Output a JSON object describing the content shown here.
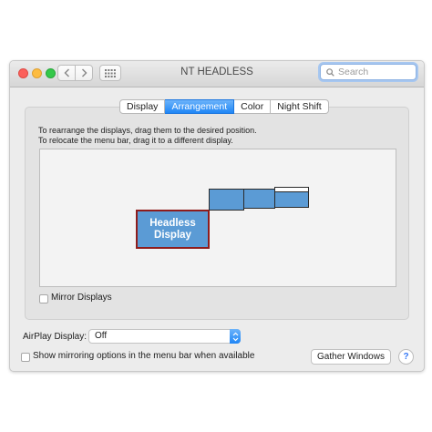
{
  "window": {
    "title": "NT HEADLESS"
  },
  "search": {
    "placeholder": "Search"
  },
  "tabs": [
    {
      "label": "Display",
      "active": false
    },
    {
      "label": "Arrangement",
      "active": true
    },
    {
      "label": "Color",
      "active": false
    },
    {
      "label": "Night Shift",
      "active": false
    }
  ],
  "instructions": {
    "line1": "To rearrange the displays, drag them to the desired position.",
    "line2": "To relocate the menu bar, drag it to a different display."
  },
  "arrangement": {
    "main_display_label_line1": "Headless",
    "main_display_label_line2": "Display"
  },
  "mirror_displays": {
    "label": "Mirror Displays",
    "checked": false
  },
  "airplay": {
    "label": "AirPlay Display:",
    "value": "Off"
  },
  "show_mirroring": {
    "label": "Show mirroring options in the menu bar when available",
    "checked": false
  },
  "buttons": {
    "gather_windows": "Gather Windows",
    "help": "?"
  },
  "colors": {
    "accent": "#1f86f6",
    "display_fill": "#5b9bd5",
    "selected_border": "#8e1c1c"
  }
}
